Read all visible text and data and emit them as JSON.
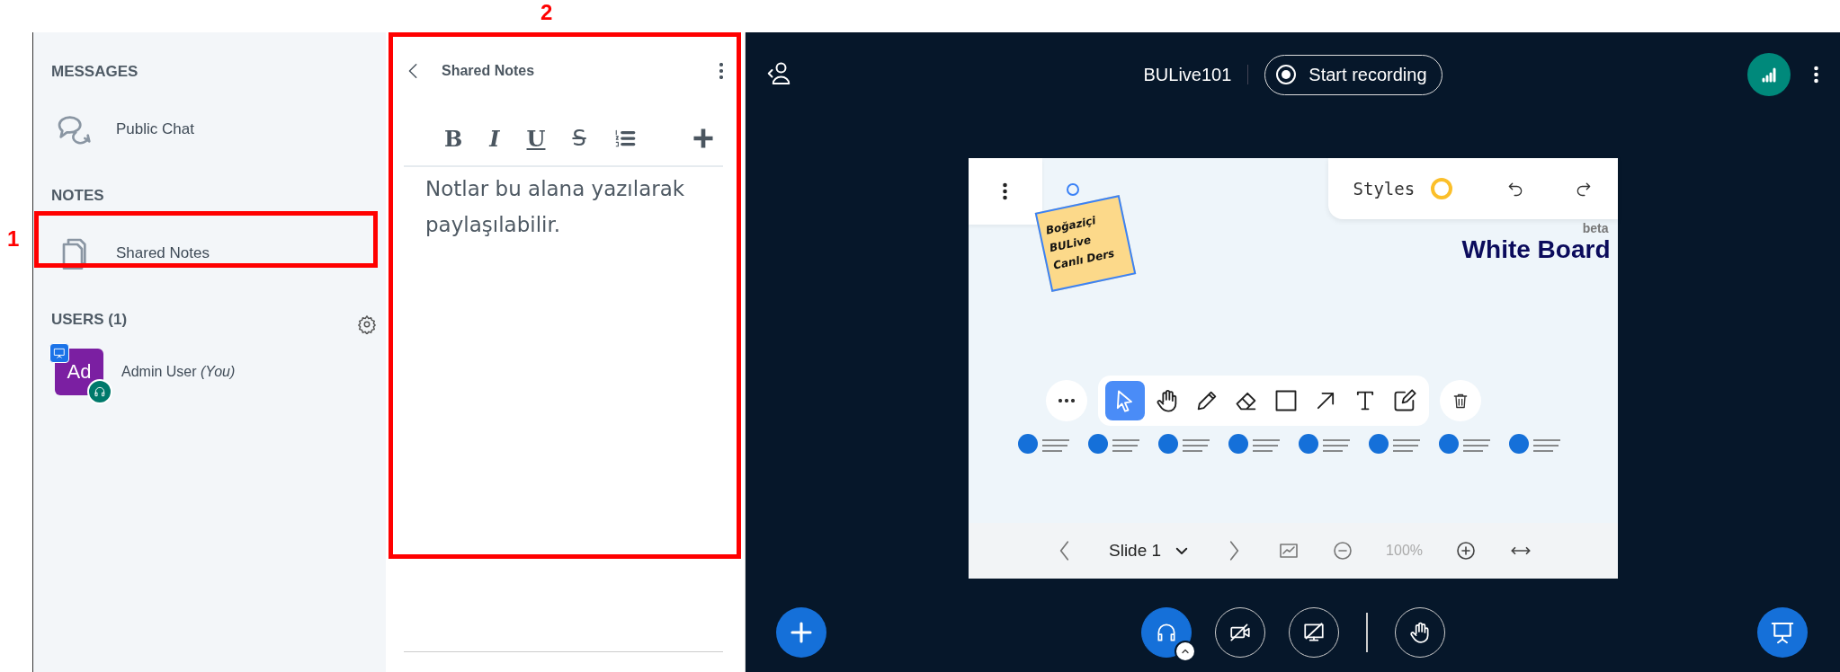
{
  "annotations": [
    {
      "label": "1"
    },
    {
      "label": "2"
    }
  ],
  "sidebar": {
    "sections": [
      {
        "title": "MESSAGES",
        "items": [
          {
            "kind": "chat",
            "label": "Public Chat"
          }
        ]
      },
      {
        "title": "NOTES",
        "items": [
          {
            "kind": "notes",
            "label": "Shared Notes"
          }
        ]
      }
    ],
    "users": {
      "title": "USERS (1)",
      "list": [
        {
          "initials": "Ad",
          "name": "Admin User",
          "suffix": "(You)",
          "presenter": true,
          "audio": true,
          "color": "#7b1fa2"
        }
      ]
    }
  },
  "notes_panel": {
    "title": "Shared Notes",
    "format_buttons": [
      "B",
      "I",
      "U",
      "S"
    ],
    "text": "Notlar bu alana yazılarak paylaşılabilir."
  },
  "top_bar": {
    "meeting_name": "BULive101",
    "record_button": "Start recording"
  },
  "whiteboard": {
    "styles_label": "Styles",
    "beta": "beta",
    "title": "White Board",
    "sticky_note": [
      "Boğaziçi",
      "BULive",
      "Canlı Ders"
    ],
    "tools": [
      {
        "kind": "select",
        "selected": true
      },
      {
        "kind": "hand",
        "selected": false
      },
      {
        "kind": "pencil",
        "selected": false
      },
      {
        "kind": "eraser",
        "selected": false
      },
      {
        "kind": "rectangle",
        "selected": false
      },
      {
        "kind": "arrow",
        "selected": false
      },
      {
        "kind": "text",
        "selected": false
      },
      {
        "kind": "note",
        "selected": false
      }
    ],
    "slide_label": "Slide 1",
    "zoom": "100%"
  },
  "controls": [
    {
      "kind": "audio",
      "on": true
    },
    {
      "kind": "video",
      "on": false
    },
    {
      "kind": "screen",
      "on": false
    },
    {
      "kind": "hand",
      "on": false
    }
  ]
}
